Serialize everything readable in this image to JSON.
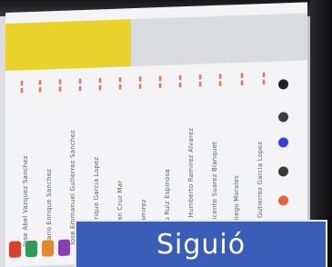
{
  "banner": {
    "text": "Siguió"
  },
  "names": [
    "Jose Abel Vazquez Sanchez",
    "Mario Enrique Sanchez",
    "Jose Emmanuel Gutierrez Sanchez",
    "Jose Enrique Garcia Lopez",
    "Jose Juan Cruz Mar",
    "Jose Ramirez",
    "Alberto Ruiz Espinosa",
    "Arturo Humberto Ramirez Alvarez",
    "Jose Vicente Suarez Blanquet",
    "Jose Diego Morales",
    "Pablo Gutierrez Garcia Lopez"
  ],
  "colors": {
    "banner": "#3a5db8",
    "highlight": "#e9d22a"
  }
}
